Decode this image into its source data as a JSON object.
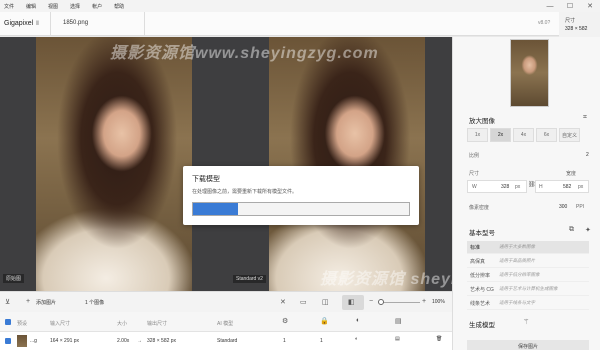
{
  "menu": {
    "items": [
      "文件",
      "编辑",
      "视图",
      "选择",
      "帐户",
      "帮助"
    ],
    "window_controls": {
      "minimize": "—",
      "maximize": "☐",
      "close": "✕"
    }
  },
  "header": {
    "app_title": "Gigapixel",
    "app_caret": "Ⅱ",
    "filename": "1850.png",
    "version": "v8.0?"
  },
  "size_info": {
    "label": "尺寸",
    "value": "328 × 582"
  },
  "canvas": {
    "left_tag": "原始图",
    "right_tag": "Standard v2"
  },
  "modal": {
    "title": "下载模型",
    "message": "在处理图像之前，需要重新下载所有模型文件。",
    "progress_percent": 21
  },
  "toolbar": {
    "add_images": "添加图片",
    "selected_count": "1 个图像",
    "zoom": "100%"
  },
  "table": {
    "headers": [
      "预设",
      "输入尺寸",
      "大小",
      "输出尺寸",
      "AI 模型"
    ],
    "row": {
      "name": "...g",
      "input_size": "164 × 291 px",
      "scale": "2.00x",
      "output_size": "328 × 582 px",
      "model": "Standard",
      "value1": "1",
      "value2": "1"
    }
  },
  "sidebar": {
    "enlarge_title": "放大图像",
    "scale_options": [
      "1x",
      "2x",
      "4x",
      "6x",
      "自定义"
    ],
    "active_scale": "2x",
    "scale_label": "比例",
    "scale_value": "2",
    "size_label": "尺寸",
    "size_unit_hint": "宽度",
    "width_label": "W",
    "width_value": "328",
    "width_unit": "px",
    "height_label": "H",
    "height_value": "582",
    "height_unit": "px",
    "density_label": "像素密度",
    "density_value": "300",
    "density_unit": "PPI",
    "model_section_title": "基本型号",
    "models": [
      {
        "name": "标准",
        "desc": "通用于大多数图像",
        "active": true
      },
      {
        "name": "高保真",
        "desc": "适用于高品质照片",
        "active": false
      },
      {
        "name": "低分辨率",
        "desc": "适用于低分辨率图像",
        "active": false
      },
      {
        "name": "艺术与 CG",
        "desc": "适用于艺术与计算机生成图像",
        "active": false
      },
      {
        "name": "线条艺术",
        "desc": "适用于线条与文字",
        "active": false
      }
    ],
    "generative_title": "生成模型",
    "save_button": "保存图片"
  },
  "watermarks": {
    "top": "摄影资源馆www.sheyingzyg.com",
    "bottom": "摄影资源馆 sheying"
  }
}
